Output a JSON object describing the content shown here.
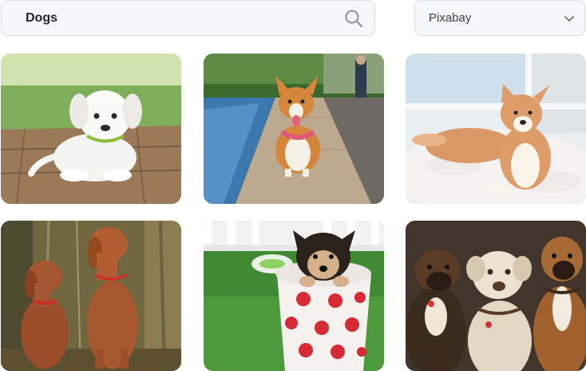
{
  "search": {
    "value": "Dogs",
    "icon": "search-icon"
  },
  "source_select": {
    "selected": "Pixabay",
    "icon": "chevron-down-icon"
  },
  "results": [
    {
      "subject": "puppy-on-deck"
    },
    {
      "subject": "corgi-on-dock"
    },
    {
      "subject": "shiba-on-rug"
    },
    {
      "subject": "vizslas-sitting"
    },
    {
      "subject": "puppy-in-polka-dot-cup"
    },
    {
      "subject": "three-dogs-portrait"
    }
  ],
  "colors": {
    "input_bg": "#f6f7f9",
    "input_border": "#d9dde3",
    "text": "#1d2330"
  }
}
